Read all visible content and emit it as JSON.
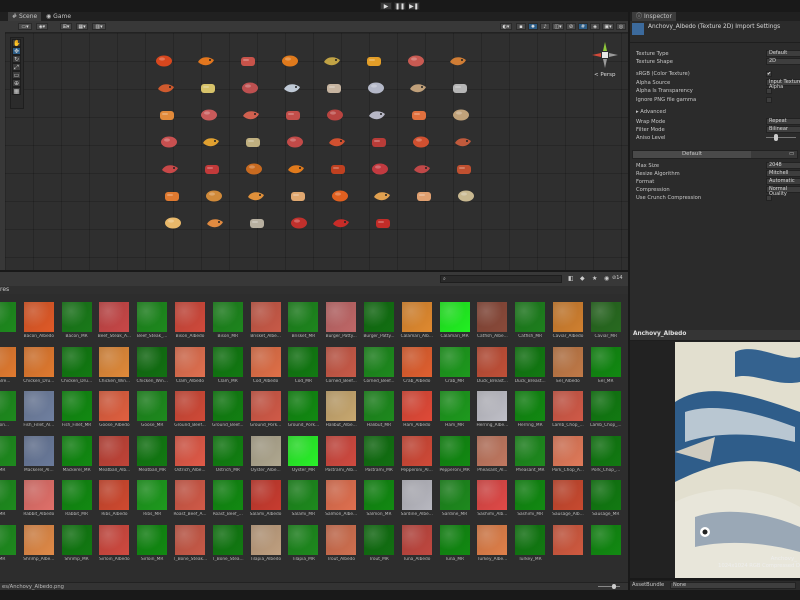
{
  "scene": {
    "tabs": [
      {
        "label": "Scene",
        "icon": "hash-icon"
      },
      {
        "label": "Game",
        "icon": "gamepad-icon"
      }
    ],
    "persp_label": "< Persp",
    "foods": [
      [
        "#d7471e",
        "#e2761e",
        "#c8534a",
        "#e07a1c",
        "#c1a345",
        "#e39e28",
        "#c85a52",
        "#d07d35"
      ],
      [
        "#cf5a2e",
        "#d7c36a",
        "#be5050",
        "#bfc9d6",
        "#c6b4a0",
        "#b4b8c8",
        "#c0a07a",
        "#b6b6b6"
      ],
      [
        "#e28a3a",
        "#c85a5a",
        "#d0604f",
        "#c24e4a",
        "#b84440",
        "#b8b8c6",
        "#e0703e",
        "#c0a27a"
      ],
      [
        "#c85050",
        "#e0a030",
        "#c0b080",
        "#c24a48",
        "#d05030",
        "#b83c38",
        "#d05030",
        "#c05a3c"
      ],
      [
        "#c84848",
        "#c23a3a",
        "#c86a20",
        "#e07a1c",
        "#c04020",
        "#c23a40",
        "#c04848",
        "#c05030"
      ],
      [
        "#e07a30",
        "#d08a3a",
        "#e0903a",
        "#e0a870",
        "#e06020",
        "#e0a050",
        "#e0a070",
        "#c8b890"
      ],
      [
        "#e8b86a",
        "#e08a40",
        "#b8b0a0",
        "#c0302c",
        "#c82c28",
        "#c22c28"
      ]
    ]
  },
  "inspector": {
    "tab_label": "Inspector",
    "title": "Anchovy_Albedo (Texture 2D) Import Settings",
    "rows": [
      {
        "label": "Texture Type",
        "value": "Default"
      },
      {
        "label": "Texture Shape",
        "value": "2D"
      },
      {
        "label": "sRGB (Color Texture)",
        "value": "✔"
      },
      {
        "label": "Alpha Source",
        "value": "Input Texture Alpha"
      },
      {
        "label": "Alpha Is Transparency",
        "value": ""
      },
      {
        "label": "Ignore PNG file gamma",
        "value": ""
      },
      {
        "label": "▸ Advanced",
        "value": ""
      },
      {
        "label": "Wrap Mode",
        "value": "Repeat"
      },
      {
        "label": "Filter Mode",
        "value": "Bilinear"
      },
      {
        "label": "Aniso Level",
        "value": ""
      }
    ],
    "platform_tab": "Default",
    "platform_rows": [
      {
        "label": "Max Size",
        "value": "2048"
      },
      {
        "label": "Resize Algorithm",
        "value": "Mitchell"
      },
      {
        "label": "Format",
        "value": "Automatic"
      },
      {
        "label": "Compression",
        "value": "Normal Quality"
      },
      {
        "label": "Use Crunch Compression",
        "value": ""
      }
    ]
  },
  "project": {
    "section_label": "res",
    "search_placeholder": "",
    "count_label": "14",
    "path": "es/Anchovy_Albedo.png",
    "rows": [
      [
        {
          "label": "",
          "color": "#1e8a1e"
        },
        {
          "label": "Bacon_Albedo",
          "color": "#e05a28"
        },
        {
          "label": "Bacon_MR",
          "color": "#1a7a1a"
        },
        {
          "label": "Beef_Steak_A...",
          "color": "#c84848"
        },
        {
          "label": "Beef_Steak_...",
          "color": "#1e8a1e"
        },
        {
          "label": "Bison_Albedo",
          "color": "#d04a3c"
        },
        {
          "label": "Bison_MR",
          "color": "#1e861e"
        },
        {
          "label": "Brisket_Albe...",
          "color": "#c85a48"
        },
        {
          "label": "Brisket_MR",
          "color": "#1e861e"
        },
        {
          "label": "Burger_Patty...",
          "color": "#c06868"
        },
        {
          "label": "Burger_Patty...",
          "color": "#127012"
        },
        {
          "label": "Calamari_Alb...",
          "color": "#e08a30"
        },
        {
          "label": "Calamari_MR",
          "color": "#22f022"
        },
        {
          "label": "Catfish_Albe...",
          "color": "#8a4a3a"
        },
        {
          "label": "Catfish_MR",
          "color": "#1e801e"
        },
        {
          "label": "Caviar_Albedo",
          "color": "#d08030"
        },
        {
          "label": "Caviar_MR",
          "color": "#286a20"
        }
      ],
      [
        {
          "label": "en_Bre...",
          "color": "#e07a30"
        },
        {
          "label": "Chicken_Dru...",
          "color": "#e07a30"
        },
        {
          "label": "Chicken_Dru...",
          "color": "#127a12"
        },
        {
          "label": "Chicken_Win...",
          "color": "#e08a3a"
        },
        {
          "label": "Chicken_Win...",
          "color": "#127012"
        },
        {
          "label": "Clam_Albedo",
          "color": "#e07050"
        },
        {
          "label": "Clam_MR",
          "color": "#127a12"
        },
        {
          "label": "Cod_Albedo",
          "color": "#e07048"
        },
        {
          "label": "Cod_MR",
          "color": "#127a12"
        },
        {
          "label": "Corned_Beef...",
          "color": "#c85a48"
        },
        {
          "label": "Corned_Beef...",
          "color": "#1e8a1e"
        },
        {
          "label": "Crab_Albedo",
          "color": "#e06030"
        },
        {
          "label": "Crab_MR",
          "color": "#1e9a1e"
        },
        {
          "label": "Duck_Breast...",
          "color": "#c05038"
        },
        {
          "label": "Duck_Breast...",
          "color": "#127a12"
        },
        {
          "label": "Eel_Albedo",
          "color": "#c07a48"
        },
        {
          "label": "Eel_MR",
          "color": "#128a12"
        }
      ],
      [
        {
          "label": "ignon...",
          "color": "#1e8a1e"
        },
        {
          "label": "Fish_Fillet_Al...",
          "color": "#7080a0"
        },
        {
          "label": "Fish_Fillet_MR",
          "color": "#128a12"
        },
        {
          "label": "Goose_Albedo",
          "color": "#e06040"
        },
        {
          "label": "Goose_MR",
          "color": "#1e8a1e"
        },
        {
          "label": "Ground_Beef...",
          "color": "#d04a38"
        },
        {
          "label": "Ground_Beef...",
          "color": "#128012"
        },
        {
          "label": "Ground_Pork...",
          "color": "#d05a48"
        },
        {
          "label": "Ground_Pork...",
          "color": "#128a12"
        },
        {
          "label": "Halibut_Albe...",
          "color": "#c8a870"
        },
        {
          "label": "Halibut_MR",
          "color": "#1e8a1e"
        },
        {
          "label": "Ham_Albedo",
          "color": "#e04a38"
        },
        {
          "label": "Ham_MR",
          "color": "#1e9a1e"
        },
        {
          "label": "Herring_Albe...",
          "color": "#c0c0c8"
        },
        {
          "label": "Herring_MR",
          "color": "#128a12"
        },
        {
          "label": "Lamb_Chop_...",
          "color": "#d05a48"
        },
        {
          "label": "Lamb_Chop_...",
          "color": "#127a12"
        }
      ],
      [
        {
          "label": "_MR",
          "color": "#1e8a1e"
        },
        {
          "label": "Mackerel_Al...",
          "color": "#6a7a9a"
        },
        {
          "label": "Mackerel_MR",
          "color": "#128a12"
        },
        {
          "label": "Meatball_Alb...",
          "color": "#c04438"
        },
        {
          "label": "Meatball_MR",
          "color": "#127a12"
        },
        {
          "label": "Ostrich_Albe...",
          "color": "#e05a48"
        },
        {
          "label": "Ostrich_MR",
          "color": "#128012"
        },
        {
          "label": "Oyster_Albe...",
          "color": "#b0a890"
        },
        {
          "label": "Oyster_MR",
          "color": "#2af02a"
        },
        {
          "label": "Pastrami_Alb...",
          "color": "#d04a40"
        },
        {
          "label": "Pastrami_MR",
          "color": "#127012"
        },
        {
          "label": "Pepperoni_Al...",
          "color": "#d04a38"
        },
        {
          "label": "Pepperoni_MR",
          "color": "#128a12"
        },
        {
          "label": "Pheasant_Al...",
          "color": "#c07860"
        },
        {
          "label": "Pheasant_MR",
          "color": "#1e8a1e"
        },
        {
          "label": "Pork_Chop_A...",
          "color": "#e07a5a"
        },
        {
          "label": "Pork_Chop_...",
          "color": "#127a12"
        }
      ],
      [
        {
          "label": "_MR",
          "color": "#1e8a1e"
        },
        {
          "label": "Rabbit_Albedo",
          "color": "#e0706a"
        },
        {
          "label": "Rabbit_MR",
          "color": "#128a12"
        },
        {
          "label": "Ribs_Albedo",
          "color": "#d04a30"
        },
        {
          "label": "Ribs_MR",
          "color": "#1e9a1e"
        },
        {
          "label": "Roast_Beef_A...",
          "color": "#d05a48"
        },
        {
          "label": "Roast_Beef_...",
          "color": "#128a12"
        },
        {
          "label": "Salami_Albedo",
          "color": "#c83c30"
        },
        {
          "label": "Salami_MR",
          "color": "#1e8a1e"
        },
        {
          "label": "Salmon_Albe...",
          "color": "#e07050"
        },
        {
          "label": "Salmon_MR",
          "color": "#128a12"
        },
        {
          "label": "Sardine_Albe...",
          "color": "#b8b8c0"
        },
        {
          "label": "Sardine_MR",
          "color": "#1e8a1e"
        },
        {
          "label": "Sashimi_Alb...",
          "color": "#e04a48"
        },
        {
          "label": "Sashimi_MR",
          "color": "#128a12"
        },
        {
          "label": "Sausage_Alb...",
          "color": "#c84a30"
        },
        {
          "label": "Sausage_MR",
          "color": "#127a12"
        }
      ],
      [
        {
          "label": "_MR",
          "color": "#1e8a1e"
        },
        {
          "label": "Shrimp_Albe...",
          "color": "#e08a48"
        },
        {
          "label": "Shrimp_MR",
          "color": "#127a12"
        },
        {
          "label": "Sirloin_Albedo",
          "color": "#d04a40"
        },
        {
          "label": "Sirloin_MR",
          "color": "#128a12"
        },
        {
          "label": "T_Bone_Steak...",
          "color": "#c85a48"
        },
        {
          "label": "T_Bone_Stea...",
          "color": "#127a12"
        },
        {
          "label": "Tilapia_Albedo",
          "color": "#c0a080"
        },
        {
          "label": "Tilapia_MR",
          "color": "#1e8a1e"
        },
        {
          "label": "Trout_Albedo",
          "color": "#d07050"
        },
        {
          "label": "Trout_MR",
          "color": "#127012"
        },
        {
          "label": "Tuna_Albedo",
          "color": "#c04840"
        },
        {
          "label": "Tuna_MR",
          "color": "#128a12"
        },
        {
          "label": "Turkey_Albe...",
          "color": "#e0804a"
        },
        {
          "label": "Turkey_MR",
          "color": "#127a12"
        },
        {
          "label": "",
          "color": "#d05a40"
        },
        {
          "label": "",
          "color": "#128a12"
        }
      ]
    ]
  },
  "preview": {
    "header": "Anchovy_Albedo",
    "caption_title": "Anchovy_",
    "caption_info": "1024x1024  RGB Compressed D",
    "assetbundle_label": "AssetBundle",
    "assetbundle_value": "None"
  },
  "colors": {
    "accent": "#2c5d87",
    "panel": "#282828"
  }
}
